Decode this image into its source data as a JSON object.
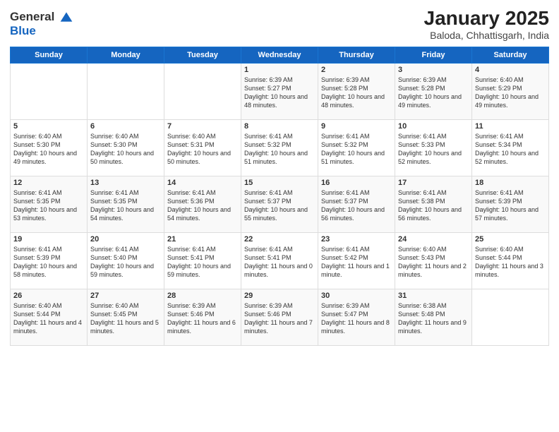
{
  "logo": {
    "general": "General",
    "blue": "Blue"
  },
  "header": {
    "month": "January 2025",
    "location": "Baloda, Chhattisgarh, India"
  },
  "weekdays": [
    "Sunday",
    "Monday",
    "Tuesday",
    "Wednesday",
    "Thursday",
    "Friday",
    "Saturday"
  ],
  "weeks": [
    [
      {
        "day": null
      },
      {
        "day": null
      },
      {
        "day": null
      },
      {
        "day": "1",
        "sunrise": "6:39 AM",
        "sunset": "5:27 PM",
        "daylight": "10 hours and 48 minutes."
      },
      {
        "day": "2",
        "sunrise": "6:39 AM",
        "sunset": "5:28 PM",
        "daylight": "10 hours and 48 minutes."
      },
      {
        "day": "3",
        "sunrise": "6:39 AM",
        "sunset": "5:28 PM",
        "daylight": "10 hours and 49 minutes."
      },
      {
        "day": "4",
        "sunrise": "6:40 AM",
        "sunset": "5:29 PM",
        "daylight": "10 hours and 49 minutes."
      }
    ],
    [
      {
        "day": "5",
        "sunrise": "6:40 AM",
        "sunset": "5:30 PM",
        "daylight": "10 hours and 49 minutes."
      },
      {
        "day": "6",
        "sunrise": "6:40 AM",
        "sunset": "5:30 PM",
        "daylight": "10 hours and 50 minutes."
      },
      {
        "day": "7",
        "sunrise": "6:40 AM",
        "sunset": "5:31 PM",
        "daylight": "10 hours and 50 minutes."
      },
      {
        "day": "8",
        "sunrise": "6:41 AM",
        "sunset": "5:32 PM",
        "daylight": "10 hours and 51 minutes."
      },
      {
        "day": "9",
        "sunrise": "6:41 AM",
        "sunset": "5:32 PM",
        "daylight": "10 hours and 51 minutes."
      },
      {
        "day": "10",
        "sunrise": "6:41 AM",
        "sunset": "5:33 PM",
        "daylight": "10 hours and 52 minutes."
      },
      {
        "day": "11",
        "sunrise": "6:41 AM",
        "sunset": "5:34 PM",
        "daylight": "10 hours and 52 minutes."
      }
    ],
    [
      {
        "day": "12",
        "sunrise": "6:41 AM",
        "sunset": "5:35 PM",
        "daylight": "10 hours and 53 minutes."
      },
      {
        "day": "13",
        "sunrise": "6:41 AM",
        "sunset": "5:35 PM",
        "daylight": "10 hours and 54 minutes."
      },
      {
        "day": "14",
        "sunrise": "6:41 AM",
        "sunset": "5:36 PM",
        "daylight": "10 hours and 54 minutes."
      },
      {
        "day": "15",
        "sunrise": "6:41 AM",
        "sunset": "5:37 PM",
        "daylight": "10 hours and 55 minutes."
      },
      {
        "day": "16",
        "sunrise": "6:41 AM",
        "sunset": "5:37 PM",
        "daylight": "10 hours and 56 minutes."
      },
      {
        "day": "17",
        "sunrise": "6:41 AM",
        "sunset": "5:38 PM",
        "daylight": "10 hours and 56 minutes."
      },
      {
        "day": "18",
        "sunrise": "6:41 AM",
        "sunset": "5:39 PM",
        "daylight": "10 hours and 57 minutes."
      }
    ],
    [
      {
        "day": "19",
        "sunrise": "6:41 AM",
        "sunset": "5:39 PM",
        "daylight": "10 hours and 58 minutes."
      },
      {
        "day": "20",
        "sunrise": "6:41 AM",
        "sunset": "5:40 PM",
        "daylight": "10 hours and 59 minutes."
      },
      {
        "day": "21",
        "sunrise": "6:41 AM",
        "sunset": "5:41 PM",
        "daylight": "10 hours and 59 minutes."
      },
      {
        "day": "22",
        "sunrise": "6:41 AM",
        "sunset": "5:41 PM",
        "daylight": "11 hours and 0 minutes."
      },
      {
        "day": "23",
        "sunrise": "6:41 AM",
        "sunset": "5:42 PM",
        "daylight": "11 hours and 1 minute."
      },
      {
        "day": "24",
        "sunrise": "6:40 AM",
        "sunset": "5:43 PM",
        "daylight": "11 hours and 2 minutes."
      },
      {
        "day": "25",
        "sunrise": "6:40 AM",
        "sunset": "5:44 PM",
        "daylight": "11 hours and 3 minutes."
      }
    ],
    [
      {
        "day": "26",
        "sunrise": "6:40 AM",
        "sunset": "5:44 PM",
        "daylight": "11 hours and 4 minutes."
      },
      {
        "day": "27",
        "sunrise": "6:40 AM",
        "sunset": "5:45 PM",
        "daylight": "11 hours and 5 minutes."
      },
      {
        "day": "28",
        "sunrise": "6:39 AM",
        "sunset": "5:46 PM",
        "daylight": "11 hours and 6 minutes."
      },
      {
        "day": "29",
        "sunrise": "6:39 AM",
        "sunset": "5:46 PM",
        "daylight": "11 hours and 7 minutes."
      },
      {
        "day": "30",
        "sunrise": "6:39 AM",
        "sunset": "5:47 PM",
        "daylight": "11 hours and 8 minutes."
      },
      {
        "day": "31",
        "sunrise": "6:38 AM",
        "sunset": "5:48 PM",
        "daylight": "11 hours and 9 minutes."
      },
      {
        "day": null
      }
    ]
  ]
}
